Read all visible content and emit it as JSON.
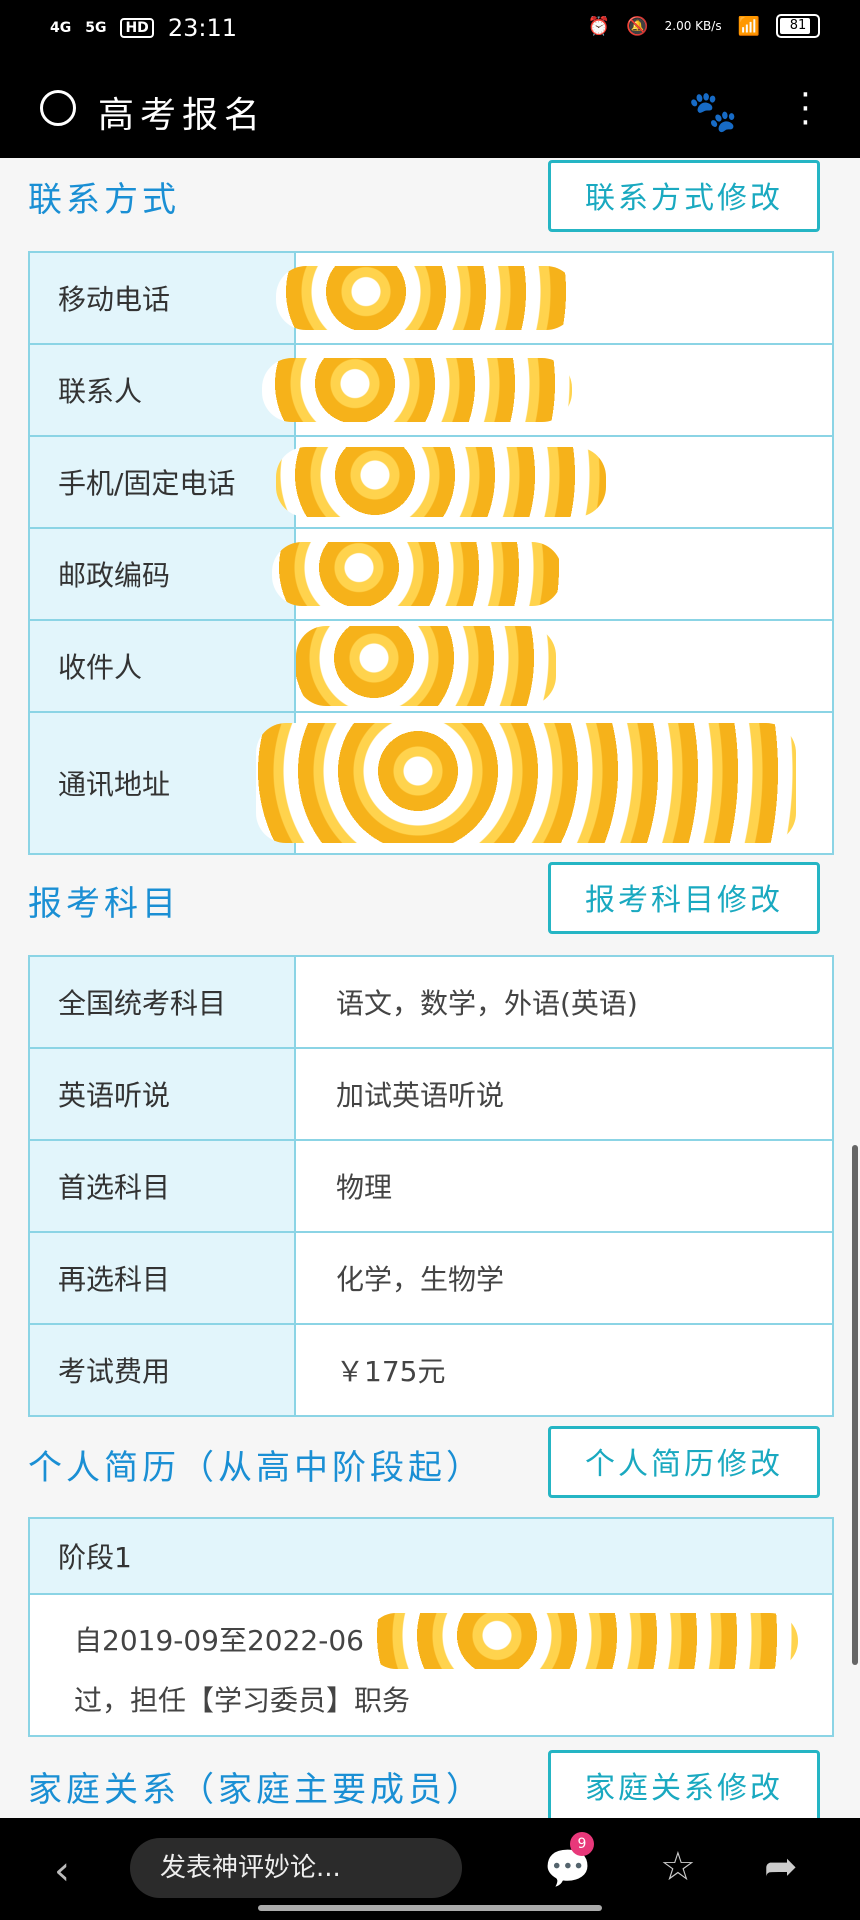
{
  "status_bar": {
    "signal_1": "4G",
    "signal_2": "5G",
    "hd": "HD",
    "time": "23:11",
    "net_speed": "2.00 KB/s",
    "battery": "81"
  },
  "search": {
    "query": "高考报名"
  },
  "sections": {
    "contact": {
      "title": "联系方式",
      "edit_label": "联系方式修改",
      "rows": [
        {
          "label": "移动电话",
          "value": ""
        },
        {
          "label": "联系人",
          "value": ""
        },
        {
          "label": "手机/固定电话",
          "value": ""
        },
        {
          "label": "邮政编码",
          "value": ""
        },
        {
          "label": "收件人",
          "value": ""
        },
        {
          "label": "通讯地址",
          "value": ""
        }
      ]
    },
    "subjects": {
      "title": "报考科目",
      "edit_label": "报考科目修改",
      "rows": [
        {
          "label": "全国统考科目",
          "value": "语文，数学，外语(英语)"
        },
        {
          "label": "英语听说",
          "value": "加试英语听说"
        },
        {
          "label": "首选科目",
          "value": "物理"
        },
        {
          "label": "再选科目",
          "value": "化学，生物学"
        },
        {
          "label": "考试费用",
          "value": "￥175元"
        }
      ]
    },
    "resume": {
      "title": "个人简历（从高中阶段起）",
      "edit_label": "个人简历修改",
      "stage_label": "阶段1",
      "line1": "自2019-09至2022-06",
      "line2": "过，担任【学习委员】职务"
    },
    "family": {
      "title": "家庭关系（家庭主要成员）",
      "edit_label": "家庭关系修改"
    }
  },
  "bottom_bar": {
    "comment_placeholder": "发表神评妙论...",
    "badge_count": "9"
  }
}
